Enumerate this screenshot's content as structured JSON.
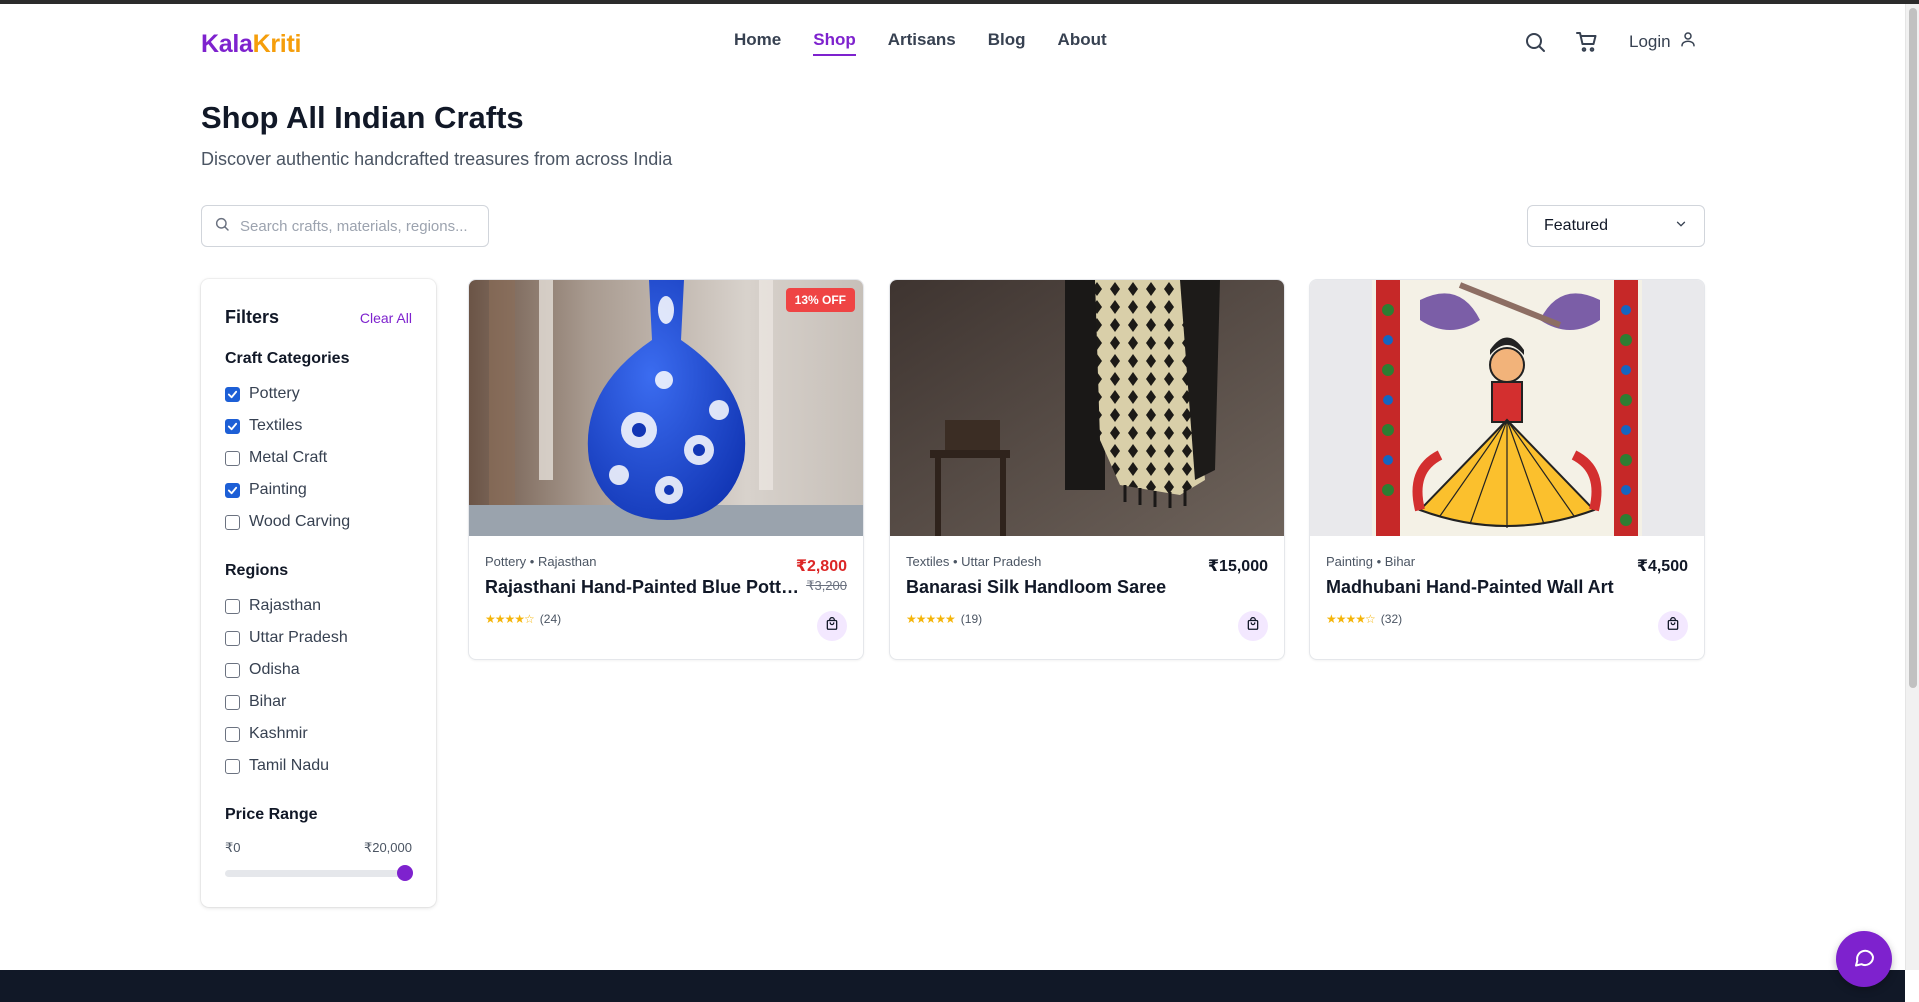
{
  "brand": {
    "part1": "Kala",
    "part2": "Kriti"
  },
  "nav": {
    "items": [
      "Home",
      "Shop",
      "Artisans",
      "Blog",
      "About"
    ],
    "active": "Shop"
  },
  "header": {
    "login_label": "Login"
  },
  "page": {
    "title": "Shop All Indian Crafts",
    "subtitle": "Discover authentic handcrafted treasures from across India"
  },
  "search": {
    "placeholder": "Search crafts, materials, regions...",
    "value": ""
  },
  "sort": {
    "selected": "Featured"
  },
  "filters": {
    "title": "Filters",
    "clear_label": "Clear All",
    "categories_title": "Craft Categories",
    "categories": [
      {
        "label": "Pottery",
        "checked": true
      },
      {
        "label": "Textiles",
        "checked": true
      },
      {
        "label": "Metal Craft",
        "checked": false
      },
      {
        "label": "Painting",
        "checked": true
      },
      {
        "label": "Wood Carving",
        "checked": false
      }
    ],
    "regions_title": "Regions",
    "regions": [
      {
        "label": "Rajasthan",
        "checked": false
      },
      {
        "label": "Uttar Pradesh",
        "checked": false
      },
      {
        "label": "Odisha",
        "checked": false
      },
      {
        "label": "Bihar",
        "checked": false
      },
      {
        "label": "Kashmir",
        "checked": false
      },
      {
        "label": "Tamil Nadu",
        "checked": false
      }
    ],
    "price_title": "Price Range",
    "price_min": "₹0",
    "price_max": "₹20,000",
    "slider_value_fraction": 1.0
  },
  "products": [
    {
      "category": "Pottery",
      "region": "Rajasthan",
      "meta": "Pottery • Rajasthan",
      "name": "Rajasthani Hand-Painted Blue Pottery Vase",
      "price": "₹2,800",
      "old_price": "₹3,200",
      "badge": "13% OFF",
      "stars": "★★★★☆",
      "reviews": "(24)"
    },
    {
      "category": "Textiles",
      "region": "Uttar Pradesh",
      "meta": "Textiles • Uttar Pradesh",
      "name": "Banarasi Silk Handloom Saree",
      "price": "₹15,000",
      "stars": "★★★★★",
      "reviews": "(19)"
    },
    {
      "category": "Painting",
      "region": "Bihar",
      "meta": "Painting • Bihar",
      "name": "Madhubani Hand-Painted Wall Art",
      "price": "₹4,500",
      "stars": "★★★★☆",
      "reviews": "(32)"
    }
  ],
  "colors": {
    "accent": "#7e22ce",
    "logo_secondary": "#f59e0b",
    "sale": "#dc2626",
    "badge": "#ef4444",
    "checkbox": "#1d5fd6",
    "footer": "#111827"
  }
}
